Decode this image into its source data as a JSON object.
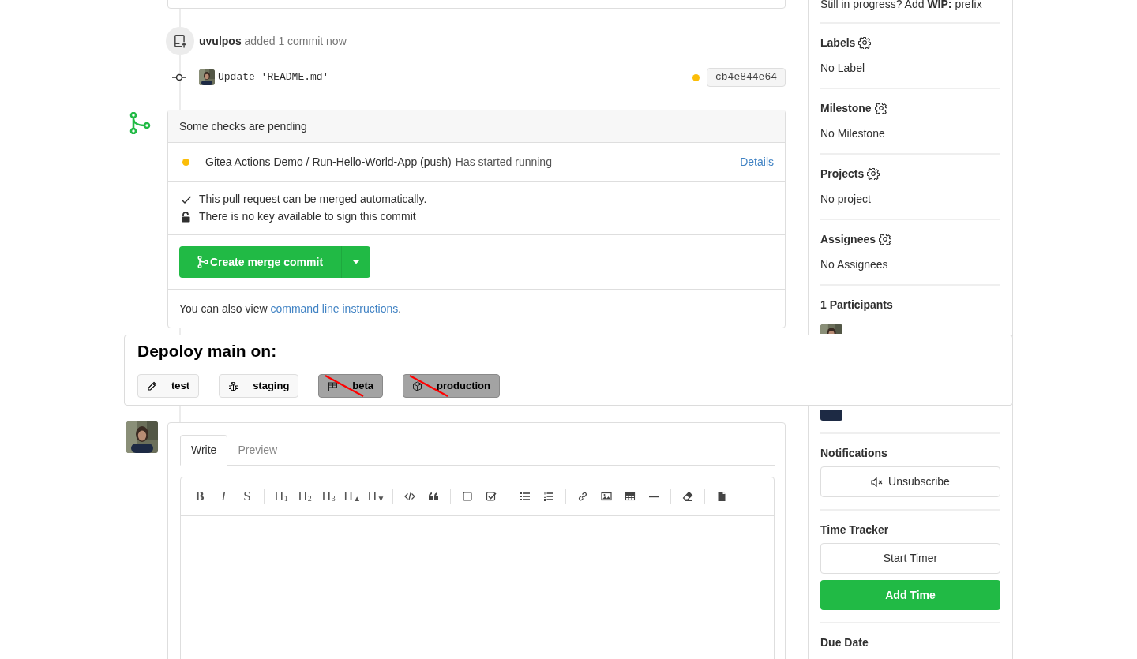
{
  "timeline_event": {
    "user": "uvulpos",
    "action": "added 1 commit now"
  },
  "commit": {
    "message": "Update 'README.md'",
    "color": "#fbbd08",
    "sha": "cb4e844e64"
  },
  "merge_box": {
    "header": "Some checks are pending",
    "checks": [
      {
        "color": "#fbbd08",
        "name": "Gitea Actions Demo / Run-Hello-World-App (push)",
        "description": "Has started running",
        "link": "Details"
      }
    ],
    "notes": [
      {
        "kind": "check",
        "text": "This pull request can be merged automatically."
      },
      {
        "kind": "unlock",
        "text": "There is no key available to sign this commit"
      }
    ],
    "merge_button": "Create merge commit",
    "footer": "You can also view",
    "footer_link": "command line instructions",
    "footer_end": "."
  },
  "deploy_panel": {
    "title": "Depoloy main on:",
    "targets": [
      {
        "label": "test",
        "disabled": false
      },
      {
        "label": "staging",
        "disabled": false
      },
      {
        "label": "beta",
        "disabled": true
      },
      {
        "label": "production",
        "disabled": true
      }
    ]
  },
  "comment_form": {
    "tabs": [
      {
        "label": "Write",
        "selected": true
      },
      {
        "label": "Preview",
        "selected": false
      }
    ],
    "toolbar": [
      [
        {
          "kind": "bold",
          "label": "B"
        },
        {
          "kind": "italic",
          "label": "I"
        },
        {
          "kind": "strike",
          "label": "S"
        }
      ],
      [
        {
          "kind": "heading",
          "label": "H$_{1}$"
        },
        {
          "kind": "heading",
          "label": "H$_{2}$"
        },
        {
          "kind": "heading",
          "label": "H$_{3}$"
        },
        {
          "kind": "heading",
          "label": "H$_{▲}$"
        },
        {
          "kind": "heading",
          "label": "H$_{▼}$"
        }
      ],
      [
        {
          "kind": "code"
        },
        {
          "kind": "quote"
        }
      ],
      [
        {
          "kind": "checkbox"
        },
        {
          "kind": "task"
        }
      ],
      [
        {
          "kind": "bullets"
        },
        {
          "kind": "numbers"
        }
      ],
      [
        {
          "kind": "link"
        },
        {
          "kind": "image"
        },
        {
          "kind": "table"
        },
        {
          "kind": "rule"
        }
      ],
      [
        {
          "kind": "eraser"
        }
      ],
      [
        {
          "kind": "file"
        }
      ]
    ]
  },
  "sidebar": {
    "wip": "Still in progress? Add **WIP:** prefix",
    "sections": [
      {
        "kind": "setting",
        "title": "Labels",
        "value": "No Label"
      },
      {
        "kind": "setting",
        "title": "Milestone",
        "value": "No Milestone"
      },
      {
        "kind": "setting",
        "title": "Projects",
        "value": "No project"
      },
      {
        "kind": "setting",
        "title": "Assignees",
        "value": "No Assignees"
      },
      {
        "kind": "participants",
        "title": "1 Participants"
      },
      {
        "kind": "notifications",
        "title": "Notifications",
        "button": "Unsubscribe"
      },
      {
        "kind": "timetracker",
        "title": "Time Tracker",
        "buttons": [
          "Start Timer",
          "Add Time"
        ]
      },
      {
        "kind": "heading",
        "title": "Due Date"
      }
    ]
  }
}
